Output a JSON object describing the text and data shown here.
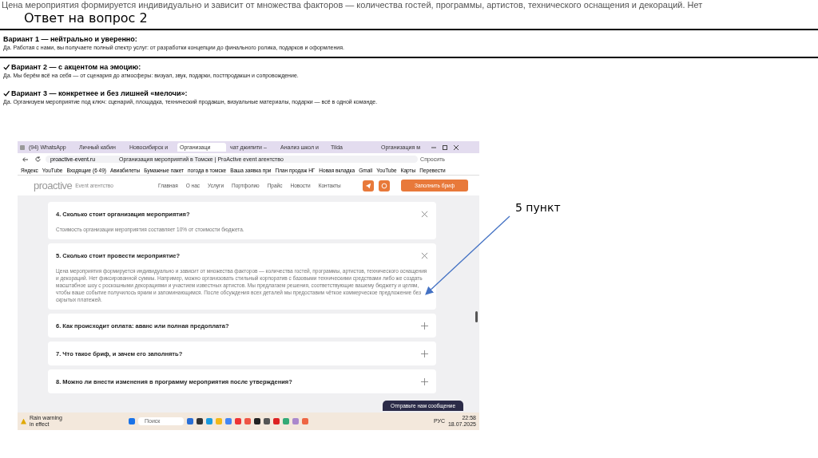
{
  "cut_line": "Цена мероприятия формируется индивидуально и зависит от множества факторов — количества гостей, программы, артистов, технического оснащения и декораций. Нет",
  "title": "Ответ на вопрос 2",
  "variants": [
    {
      "heading": "Вариант 1 — нейтрально и уверенно:",
      "checked": false,
      "text": "Да. Работая с нами, вы получаете полный спектр услуг: от разработки концепции до финального ролика, подарков и оформления."
    },
    {
      "heading": "Вариант 2 — с акцентом на эмоцию:",
      "checked": true,
      "text": "Да. Мы берём всё на себя — от сценария до атмосферы: визуал, звук, подарки, постпродакшн и сопровождение."
    },
    {
      "heading": "Вариант 3 — конкретнее и без лишней «мелочи»:",
      "checked": true,
      "text": "Да. Организуем мероприятие под ключ: сценарий, площадка, технический продакшн, визуальные материалы, подарки — всё в одной команде."
    }
  ],
  "screenshot": {
    "tabs": [
      {
        "label": "(94) WhatsApp",
        "selected": false
      },
      {
        "label": "Личный кабин",
        "selected": false
      },
      {
        "label": "Новосибирск и",
        "selected": false
      },
      {
        "label": "Организаци",
        "selected": true
      },
      {
        "label": "чат джипити –",
        "selected": false
      },
      {
        "label": "Анализ школ и",
        "selected": false
      },
      {
        "label": "Tilda",
        "selected": false
      },
      {
        "label": "Организация м",
        "selected": false
      }
    ],
    "address": "proactive-event.ru",
    "page_title": "Организация мероприятий в Томске | ProActive event агентство",
    "ask_button": "Спросить",
    "bookmarks": [
      "Яндекс",
      "YouTube",
      "Входящие (6 49)",
      "Авиабилеты",
      "Бумажные пакет",
      "погода в томске",
      "Ваша заявка при",
      "План продаж НГ",
      "Новая вкладка",
      "Gmail",
      "YouTube",
      "Карты",
      "Перевести"
    ],
    "site": {
      "logo": "proactive",
      "logo_sub": "Event агентство",
      "nav": [
        "Главная",
        "О нас",
        "Услуги",
        "Портфолио",
        "Прайс",
        "Новости",
        "Контакты"
      ],
      "cta": "Заполнить бриф"
    },
    "faq": [
      {
        "question": "4. Сколько стоит организация мероприятия?",
        "expanded": true,
        "answer": "Стоимость организации мероприятия составляет 10% от стоимости бюджета."
      },
      {
        "question": "5. Сколько стоит провести мероприятие?",
        "expanded": true,
        "answer": "Цена мероприятия формируется индивидуально и зависит от множества факторов — количества гостей, программы, артистов, технического оснащения и декораций. Нет фиксированной суммы. Например, можно организовать стильный корпоратив с базовыми техническими средствами либо же создать масштабное шоу с роскошными декорациями и участием известных артистов. Мы предлагаем решения, соответствующие вашему бюджету и целям, чтобы ваше событие получилось ярким и запоминающимся. После обсуждения всех деталей мы предоставим чёткое коммерческое предложение без скрытых платежей."
      },
      {
        "question": "6. Как происходит оплата: аванс или полная предоплата?",
        "expanded": false
      },
      {
        "question": "7. Что такое бриф, и зачем его заполнять?",
        "expanded": false
      },
      {
        "question": "8. Можно ли внести изменения в программу мероприятия после утверждения?",
        "expanded": false
      }
    ],
    "chat_button": "Отправьте нам сообщение",
    "taskbar": {
      "weather_title": "Rain warning",
      "weather_sub": "in effect",
      "search": "Поиск",
      "lang": "РУС",
      "time": "22:58",
      "date": "18.07.2025"
    }
  },
  "annotation": "5 пункт"
}
